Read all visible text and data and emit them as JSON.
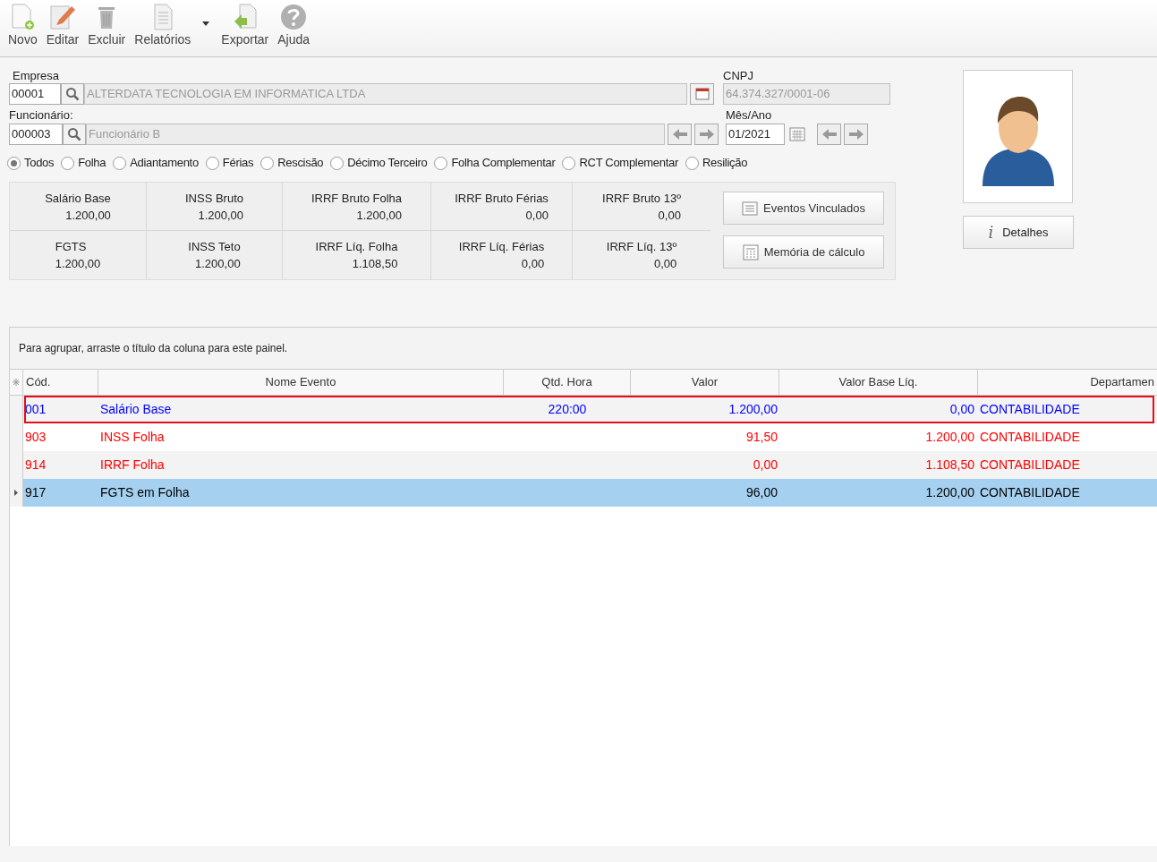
{
  "toolbar": [
    {
      "kind": "new",
      "label": "Novo"
    },
    {
      "kind": "edit",
      "label": "Editar"
    },
    {
      "kind": "delete",
      "label": "Excluir"
    },
    {
      "kind": "reports",
      "label": "Relatórios",
      "dropdown": true
    },
    {
      "kind": "export",
      "label": "Exportar"
    },
    {
      "kind": "help",
      "label": "Ajuda"
    }
  ],
  "empresa": {
    "label": "Empresa",
    "code": "00001",
    "name": "ALTERDATA TECNOLOGIA EM INFORMATICA LTDA"
  },
  "cnpj": {
    "label": "CNPJ",
    "value": "64.374.327/0001-06"
  },
  "funcionario": {
    "label": "Funcionário:",
    "code": "000003",
    "name": "Funcionário B"
  },
  "mes_ano": {
    "label": "Mês/Ano",
    "value": "01/2021"
  },
  "filters": [
    {
      "label": "Todos",
      "selected": true
    },
    {
      "label": "Folha",
      "selected": false
    },
    {
      "label": "Adiantamento",
      "selected": false
    },
    {
      "label": "Férias",
      "selected": false
    },
    {
      "label": "Rescisão",
      "selected": false
    },
    {
      "label": "Décimo Terceiro",
      "selected": false
    },
    {
      "label": "Folha Complementar",
      "selected": false
    },
    {
      "label": "RCT Complementar",
      "selected": false
    },
    {
      "label": "Resilição",
      "selected": false
    }
  ],
  "summary": [
    [
      {
        "label": "Salário Base",
        "value": "1.200,00"
      },
      {
        "label": "INSS Bruto",
        "value": "1.200,00"
      },
      {
        "label": "IRRF Bruto Folha",
        "value": "1.200,00"
      },
      {
        "label": "IRRF Bruto Férias",
        "value": "0,00"
      },
      {
        "label": "IRRF Bruto 13º",
        "value": "0,00"
      }
    ],
    [
      {
        "label": "FGTS",
        "value": "1.200,00"
      },
      {
        "label": "INSS Teto",
        "value": "1.200,00"
      },
      {
        "label": "IRRF Líq. Folha",
        "value": "1.108,50"
      },
      {
        "label": "IRRF Líq. Férias",
        "value": "0,00"
      },
      {
        "label": "IRRF Líq. 13º",
        "value": "0,00"
      }
    ]
  ],
  "side_buttons": [
    {
      "kind": "list",
      "label": "Eventos Vinculados"
    },
    {
      "kind": "calc",
      "label": "Memória de cálculo"
    }
  ],
  "details_button": {
    "icon": "i",
    "label": "Detalhes"
  },
  "grid": {
    "group_hint": "Para agrupar, arraste o título da coluna para este painel.",
    "columns": [
      "Cód.",
      "Nome Evento",
      "Qtd. Hora",
      "Valor",
      "Valor Base Líq.",
      "Departamen"
    ],
    "rows": [
      {
        "cells": [
          "001",
          "Salário Base",
          "220:00",
          "1.200,00",
          "0,00",
          "CONTABILIDADE"
        ],
        "color": "#0000ff",
        "selected": false,
        "highlighted": true
      },
      {
        "cells": [
          "903",
          "INSS Folha",
          "",
          "91,50",
          "1.200,00",
          "CONTABILIDADE"
        ],
        "color": "#ff0000",
        "selected": false,
        "highlighted": false
      },
      {
        "cells": [
          "914",
          "IRRF Folha",
          "",
          "0,00",
          "1.108,50",
          "CONTABILIDADE"
        ],
        "color": "#ff0000",
        "selected": false,
        "highlighted": false
      },
      {
        "cells": [
          "917",
          "FGTS em Folha",
          "",
          "96,00",
          "1.200,00",
          "CONTABILIDADE"
        ],
        "color": "#000000",
        "selected": true,
        "highlighted": false
      }
    ]
  }
}
